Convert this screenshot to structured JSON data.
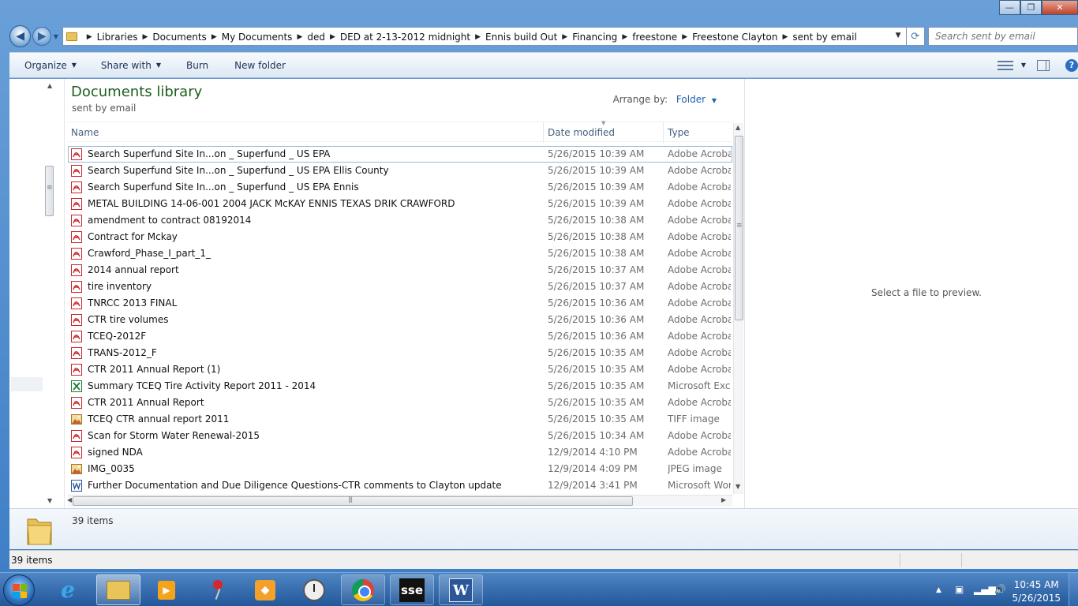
{
  "window": {
    "caption_buttons": {
      "minimize": "—",
      "maximize": "❐",
      "close": "✕"
    }
  },
  "address": {
    "breadcrumbs": [
      "Libraries",
      "Documents",
      "My Documents",
      "ded",
      "DED at 2-13-2012 midnight",
      "Ennis build Out",
      "Financing",
      "freestone",
      "Freestone Clayton",
      "sent by email"
    ],
    "search_placeholder": "Search sent by email"
  },
  "toolbar": {
    "organize": "Organize",
    "share_with": "Share with",
    "burn": "Burn",
    "new_folder": "New folder"
  },
  "library": {
    "title": "Documents library",
    "subtitle": "sent by email",
    "arrange_label": "Arrange by:",
    "arrange_value": "Folder"
  },
  "columns": {
    "name": "Name",
    "date": "Date modified",
    "type": "Type"
  },
  "files": [
    {
      "name": "Search Superfund Site In...on _ Superfund _ US EPA",
      "date": "5/26/2015 10:39 AM",
      "type": "Adobe Acrobat",
      "icon": "pdf-icon"
    },
    {
      "name": "Search Superfund Site In...on _ Superfund _ US EPA Ellis County",
      "date": "5/26/2015 10:39 AM",
      "type": "Adobe Acrobat",
      "icon": "pdf-icon"
    },
    {
      "name": "Search Superfund Site In...on _ Superfund _ US EPA Ennis",
      "date": "5/26/2015 10:39 AM",
      "type": "Adobe Acrobat",
      "icon": "pdf-icon"
    },
    {
      "name": "METAL BUILDING 14-06-001 2004 JACK McKAY ENNIS TEXAS DRIK CRAWFORD",
      "date": "5/26/2015 10:39 AM",
      "type": "Adobe Acrobat",
      "icon": "pdf-icon"
    },
    {
      "name": "amendment to contract 08192014",
      "date": "5/26/2015 10:38 AM",
      "type": "Adobe Acrobat",
      "icon": "pdf-icon"
    },
    {
      "name": "Contract for Mckay",
      "date": "5/26/2015 10:38 AM",
      "type": "Adobe Acrobat",
      "icon": "pdf-icon"
    },
    {
      "name": "Crawford_Phase_I_part_1_",
      "date": "5/26/2015 10:38 AM",
      "type": "Adobe Acrobat",
      "icon": "pdf-icon"
    },
    {
      "name": "2014 annual report",
      "date": "5/26/2015 10:37 AM",
      "type": "Adobe Acrobat",
      "icon": "pdf-icon"
    },
    {
      "name": "tire inventory",
      "date": "5/26/2015 10:37 AM",
      "type": "Adobe Acrobat",
      "icon": "pdf-icon"
    },
    {
      "name": "TNRCC 2013 FINAL",
      "date": "5/26/2015 10:36 AM",
      "type": "Adobe Acrobat",
      "icon": "pdf-icon"
    },
    {
      "name": "CTR tire volumes",
      "date": "5/26/2015 10:36 AM",
      "type": "Adobe Acrobat",
      "icon": "pdf-icon"
    },
    {
      "name": "TCEQ-2012F",
      "date": "5/26/2015 10:36 AM",
      "type": "Adobe Acrobat",
      "icon": "pdf-icon"
    },
    {
      "name": "TRANS-2012_F",
      "date": "5/26/2015 10:35 AM",
      "type": "Adobe Acrobat",
      "icon": "pdf-icon"
    },
    {
      "name": "CTR 2011 Annual Report (1)",
      "date": "5/26/2015 10:35 AM",
      "type": "Adobe Acrobat",
      "icon": "pdf-icon"
    },
    {
      "name": "Summary TCEQ Tire Activity Report 2011 - 2014",
      "date": "5/26/2015 10:35 AM",
      "type": "Microsoft Excel",
      "icon": "excel-icon"
    },
    {
      "name": "CTR 2011 Annual Report",
      "date": "5/26/2015 10:35 AM",
      "type": "Adobe Acrobat",
      "icon": "pdf-icon"
    },
    {
      "name": "TCEQ CTR annual report 2011",
      "date": "5/26/2015 10:35 AM",
      "type": "TIFF image",
      "icon": "image-icon"
    },
    {
      "name": "Scan for Storm Water Renewal-2015",
      "date": "5/26/2015 10:34 AM",
      "type": "Adobe Acrobat",
      "icon": "pdf-icon"
    },
    {
      "name": "signed NDA",
      "date": "12/9/2014 4:10 PM",
      "type": "Adobe Acrobat",
      "icon": "pdf-icon"
    },
    {
      "name": "IMG_0035",
      "date": "12/9/2014 4:09 PM",
      "type": "JPEG image",
      "icon": "image-icon"
    },
    {
      "name": "Further Documentation and Due Diligence Questions-CTR comments to Clayton update",
      "date": "12/9/2014 3:41 PM",
      "type": "Microsoft Word",
      "icon": "word-icon"
    }
  ],
  "preview": {
    "message": "Select a file to preview."
  },
  "details": {
    "count": "39 items"
  },
  "status": {
    "text": "39 items"
  },
  "taskbar": {
    "apps": [
      "internet-explorer",
      "windows-explorer",
      "media-player",
      "pin-app",
      "firefox-like",
      "clock-app",
      "chrome",
      "sse",
      "word"
    ],
    "sse_label": "sse",
    "word_label": "W",
    "time": "10:45 AM",
    "date": "5/26/2015"
  },
  "colors": {
    "library_title": "#1d5f1d",
    "link_blue": "#1f5fae",
    "pdf_red": "#c8262c",
    "excel_green": "#1f7a3a",
    "word_blue": "#2b579a",
    "taskbar": "#22579a"
  }
}
